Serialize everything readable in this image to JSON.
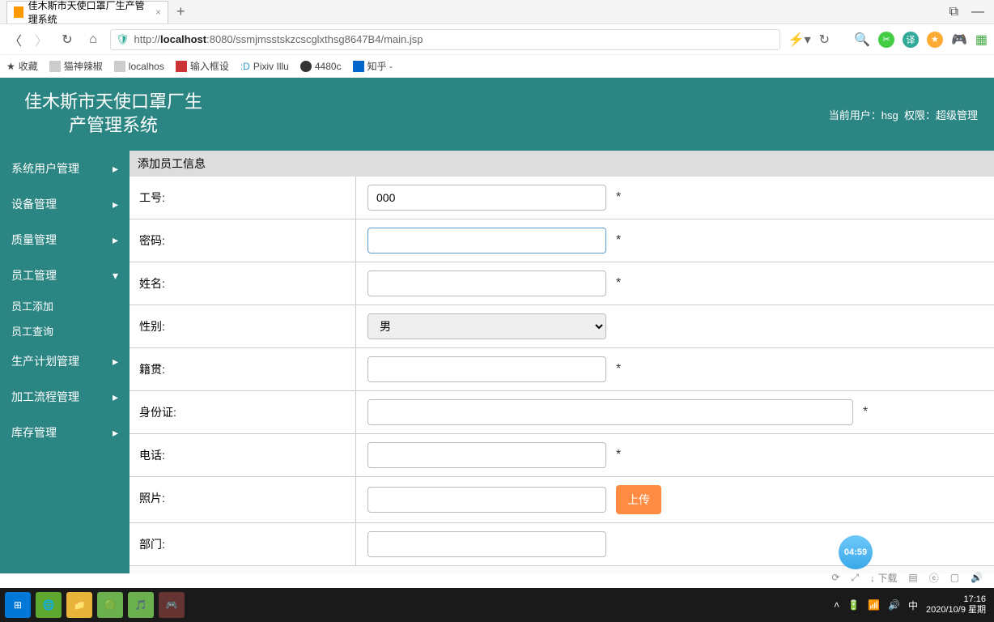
{
  "browser": {
    "tab_title": "佳木斯市天使口罩厂生产管理系统",
    "url_prefix": "http://",
    "url_host": "localhost",
    "url_port": ":8080",
    "url_path": "/ssmjmsstskzcscglxthsg8647B4/main.jsp"
  },
  "bookmarks": [
    "收藏",
    "猫神辣椒",
    "localhos",
    "输入框设",
    "Pixiv Illu",
    "4480c",
    "知乎 -"
  ],
  "app": {
    "title_line1": "佳木斯市天使口罩厂生",
    "title_line2": "产管理系统",
    "user_label": "当前用户：",
    "user_name": "hsg",
    "perm_label": "权限：",
    "perm_value": "超级管理"
  },
  "menu": [
    {
      "label": "系统用户管理",
      "expand": "▸"
    },
    {
      "label": "设备管理",
      "expand": "▸"
    },
    {
      "label": "质量管理",
      "expand": "▸"
    },
    {
      "label": "员工管理",
      "expand": "▾",
      "subs": [
        "员工添加",
        "员工查询"
      ]
    },
    {
      "label": "生产计划管理",
      "expand": "▸"
    },
    {
      "label": "加工流程管理",
      "expand": "▸"
    },
    {
      "label": "库存管理",
      "expand": "▸"
    }
  ],
  "form": {
    "title": "添加员工信息",
    "fields": {
      "id": {
        "label": "工号:",
        "value": "000",
        "required": "*"
      },
      "password": {
        "label": "密码:",
        "value": "",
        "required": "*"
      },
      "name": {
        "label": "姓名:",
        "value": "",
        "required": "*"
      },
      "gender": {
        "label": "性别:",
        "value": "男"
      },
      "origin": {
        "label": "籍贯:",
        "value": "",
        "required": "*"
      },
      "idcard": {
        "label": "身份证:",
        "value": "",
        "required": "*"
      },
      "phone": {
        "label": "电话:",
        "value": "",
        "required": "*"
      },
      "photo": {
        "label": "照片:",
        "upload": "上传"
      },
      "dept": {
        "label": "部门:"
      }
    }
  },
  "float_timer": "04:59",
  "download_label": "下载",
  "clock": {
    "time": "17:16",
    "date": "2020/10/9 星期",
    "ime": "中"
  }
}
